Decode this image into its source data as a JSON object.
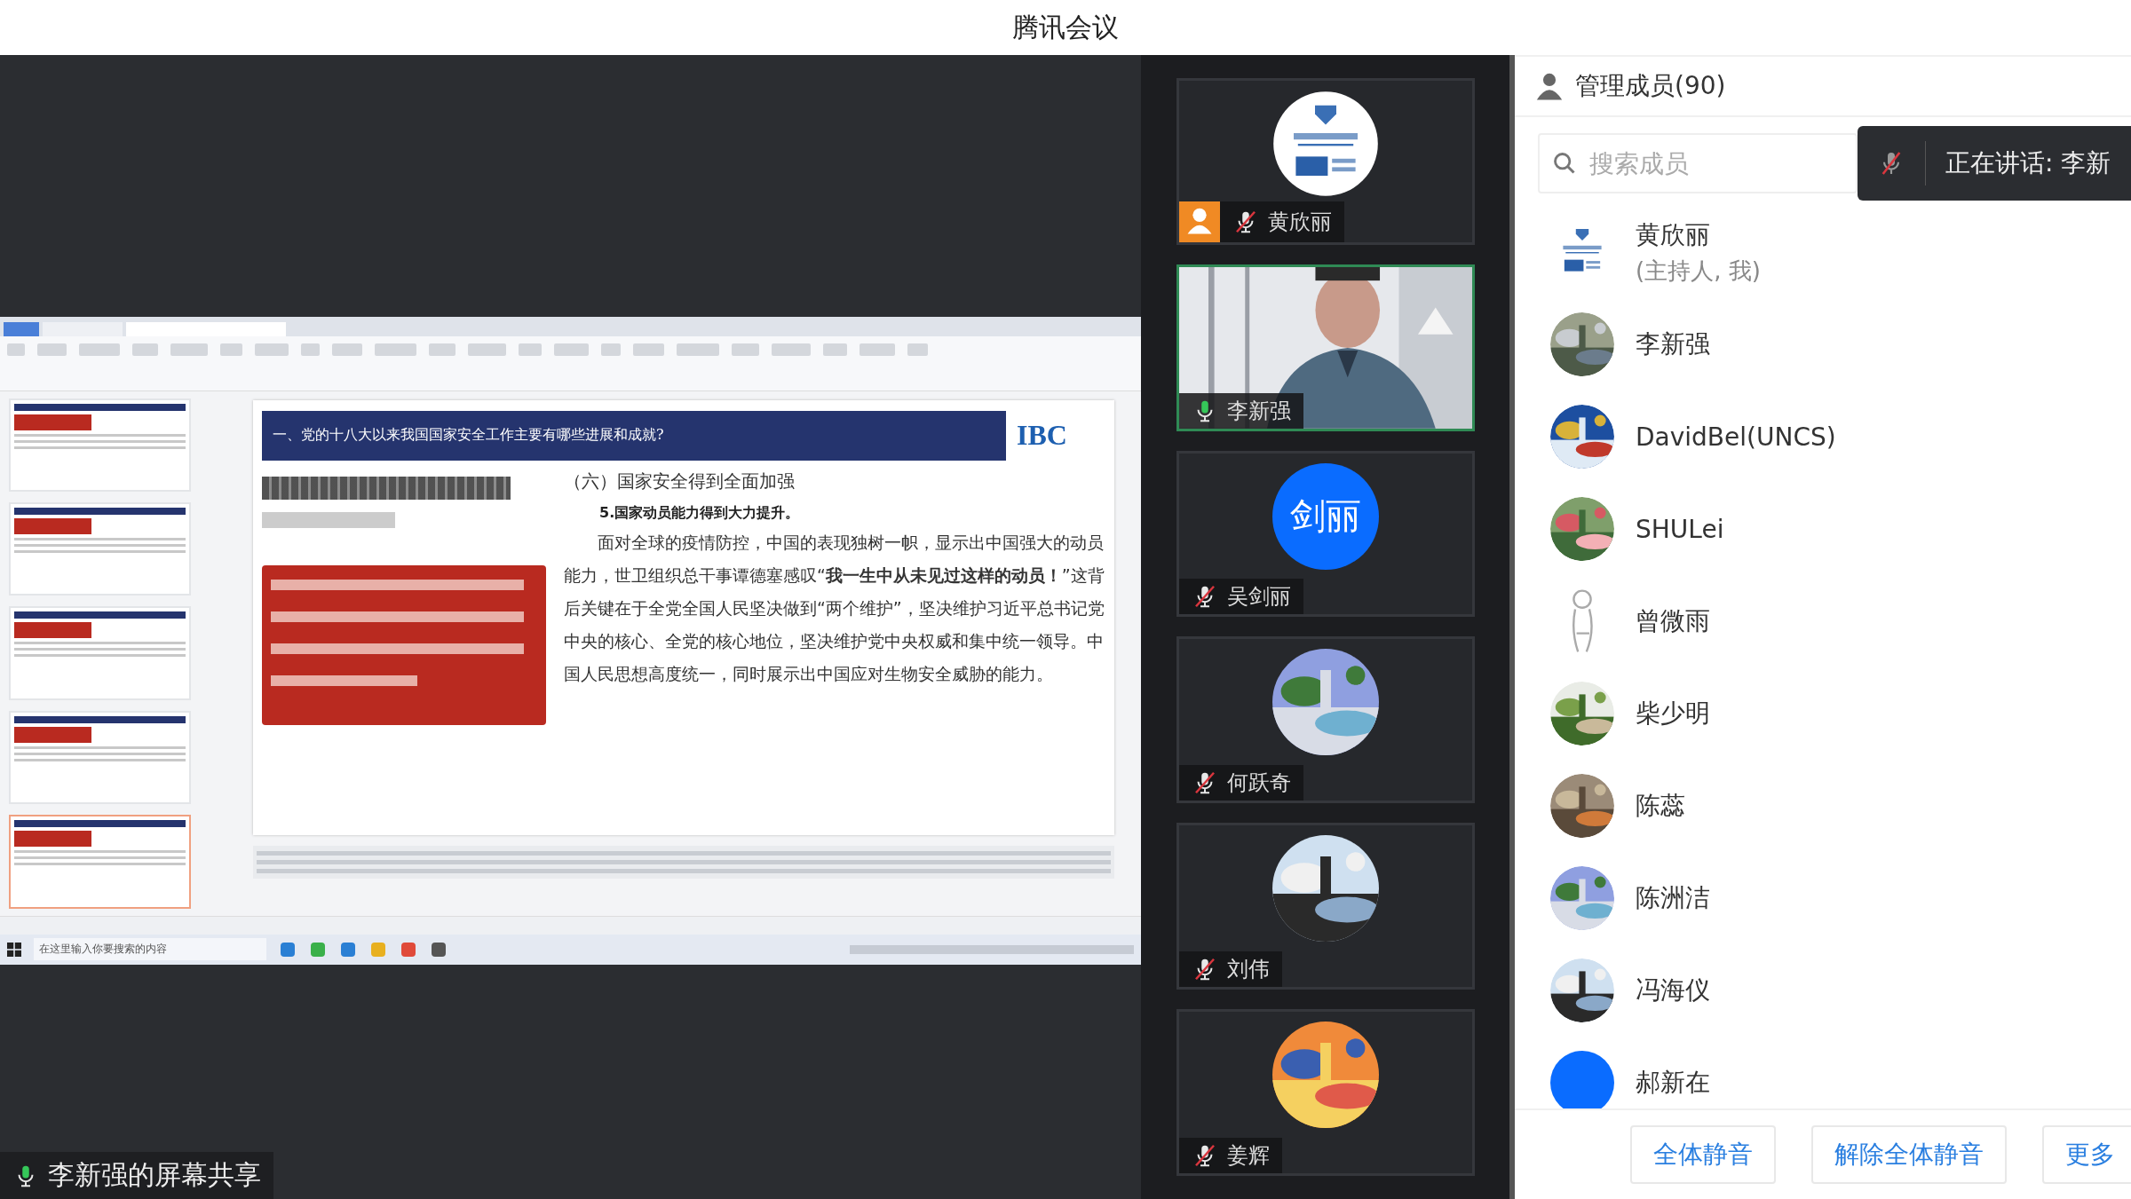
{
  "window": {
    "title": "腾讯会议"
  },
  "shared_screen": {
    "label": "李新强的屏幕共享",
    "mic_active": true,
    "document": {
      "taskbar_search": "在这里输入你要搜索的内容",
      "slide": {
        "header": "一、党的十八大以来我国国家安全工作主要有哪些进展和成就?",
        "logo": "IBC",
        "heading": "（六）国家安全得到全面加强",
        "subheading": "5.国家动员能力得到大力提升。",
        "paragraph": "面对全球的疫情防控，中国的表现独树一帜，显示出中国强大的动员能力，世卫组织总干事谭德塞感叹“**我一生中从未见过这样的动员！**”这背后关键在于全党全国人民坚决做到“两个维护”，坚决维护习近平总书记党中央的核心、全党的核心地位，坚决维护党中央权威和集中统一领导。中国人民思想高度统一，同时展示出中国应对生物安全威胁的能力。"
      }
    }
  },
  "video_tiles": [
    {
      "name": "黄欣丽",
      "avatar": {
        "kind": "logo"
      },
      "host": true,
      "muted": true,
      "speaking": false
    },
    {
      "name": "李新强",
      "avatar": {
        "kind": "video"
      },
      "host": false,
      "muted": false,
      "speaking": true
    },
    {
      "name": "吴剑丽",
      "avatar": {
        "kind": "initials",
        "text": "剑丽"
      },
      "host": false,
      "muted": true,
      "speaking": false
    },
    {
      "name": "何跃奇",
      "host": false,
      "muted": true,
      "speaking": false
    },
    {
      "name": "刘伟",
      "host": false,
      "muted": true,
      "speaking": false
    },
    {
      "name": "姜辉",
      "host": false,
      "muted": true,
      "speaking": false
    }
  ],
  "members_panel": {
    "title": "管理成员(90)",
    "search": {
      "placeholder": "搜索成员"
    },
    "speaking_toast": {
      "text": "正在讲话: 李新"
    },
    "members": [
      {
        "name": "黄欣丽",
        "role": "(主持人, 我)",
        "avatar": {
          "kind": "logo"
        }
      },
      {
        "name": "李新强"
      },
      {
        "name": "DavidBel(UNCS)"
      },
      {
        "name": "SHULei"
      },
      {
        "name": "曾微雨",
        "avatar": {
          "kind": "sketch"
        }
      },
      {
        "name": "柴少明"
      },
      {
        "name": "陈蕊"
      },
      {
        "name": "陈洲洁"
      },
      {
        "name": "冯海仪"
      },
      {
        "name": "郝新在",
        "avatar": {
          "kind": "initials"
        }
      }
    ],
    "buttons": [
      "全体静音",
      "解除全体静音",
      "更多"
    ]
  }
}
